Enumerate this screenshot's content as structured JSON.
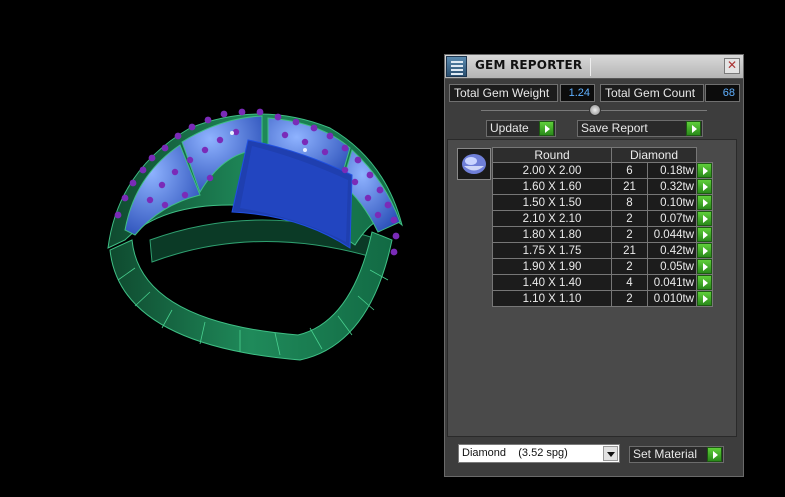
{
  "panel": {
    "title": "GEM REPORTER",
    "close_glyph": "✕",
    "total_weight_label": "Total Gem Weight",
    "total_weight_value": "1.24",
    "total_count_label": "Total Gem Count",
    "total_count_value": "68",
    "update_label": "Update",
    "save_report_label": "Save Report",
    "shape_header": "Round",
    "material_header": "Diamond",
    "rows": [
      {
        "size": "2.00 X 2.00",
        "count": "6",
        "weight": "0.18tw"
      },
      {
        "size": "1.60 X 1.60",
        "count": "21",
        "weight": "0.32tw"
      },
      {
        "size": "1.50 X 1.50",
        "count": "8",
        "weight": "0.10tw"
      },
      {
        "size": "2.10 X 2.10",
        "count": "2",
        "weight": "0.07tw"
      },
      {
        "size": "1.80 X 1.80",
        "count": "2",
        "weight": "0.044tw"
      },
      {
        "size": "1.75 X 1.75",
        "count": "21",
        "weight": "0.42tw"
      },
      {
        "size": "1.90 X 1.90",
        "count": "2",
        "weight": "0.05tw"
      },
      {
        "size": "1.40 X 1.40",
        "count": "4",
        "weight": "0.041tw"
      },
      {
        "size": "1.10 X 1.10",
        "count": "2",
        "weight": "0.010tw"
      }
    ],
    "material_select": "Diamond    (3.52 spg)",
    "set_material_label": "Set Material"
  },
  "icons": {
    "app": "gem-reporter-app-icon",
    "close": "close-icon",
    "play": "play-arrow-icon",
    "gem": "round-gem-icon",
    "dropdown": "chevron-down-icon"
  },
  "colors": {
    "metal": "#1f8a5a",
    "sapphire": "#1f3fb0",
    "amethyst": "#7a2bb8",
    "value_text": "#5fb0ff",
    "play_green": "#3fae27"
  }
}
